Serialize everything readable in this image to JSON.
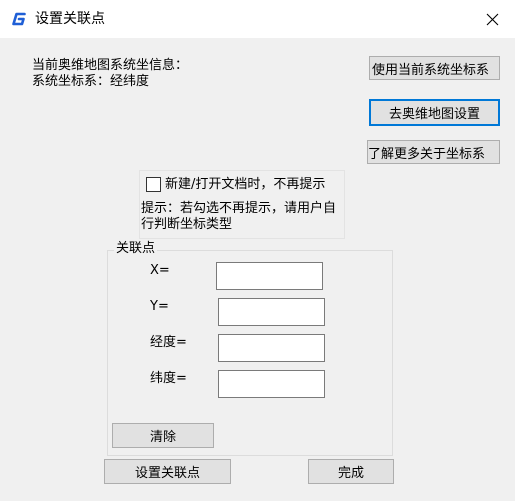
{
  "window": {
    "title": "设置关联点",
    "app_icon": "g-logo-icon",
    "close_icon": "close-icon",
    "accent_color": "#0078d7"
  },
  "info": {
    "line1": "当前奥维地图系统坐信息：",
    "line2": "系统坐标系：经纬度"
  },
  "buttons": {
    "use_current": "使用当前系统坐标系",
    "goto_settings": "去奥维地图设置",
    "learn_more": "了解更多关于坐标系",
    "clear": "清除",
    "set_points": "设置关联点",
    "done": "完成"
  },
  "notice": {
    "checkbox_label": "新建/打开文档时，不再提示",
    "checked": false,
    "hint": "提示：若勾选不再提示，请用户自行判断坐标类型"
  },
  "group": {
    "title": "关联点",
    "fields": [
      {
        "label": "X=",
        "value": ""
      },
      {
        "label": "Y=",
        "value": ""
      },
      {
        "label": "经度=",
        "value": ""
      },
      {
        "label": "纬度=",
        "value": ""
      }
    ]
  }
}
